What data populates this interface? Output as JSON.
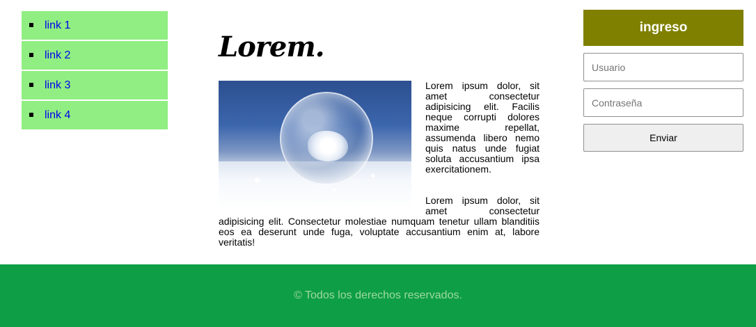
{
  "nav": {
    "items": [
      {
        "label": "link 1"
      },
      {
        "label": "link 2"
      },
      {
        "label": "link 3"
      },
      {
        "label": "link 4"
      }
    ],
    "item_color": "#90ee82",
    "link_color": "#0000ee"
  },
  "main": {
    "title": "Lorem.",
    "image": {
      "icon": "frozen-bubble-photo"
    },
    "paragraphs": [
      "Lorem ipsum dolor, sit amet consectetur adipisicing elit. Facilis neque corrupti dolores maxime repellat, assumenda libero nemo quis natus unde fugiat soluta accusantium ipsa exercitationem.",
      "Lorem ipsum dolor, sit amet consectetur adipisicing elit. Consectetur molestiae numquam tenetur ullam blanditiis eos ea deserunt unde fuga, voluptate accusantium enim at, labore veritatis!"
    ]
  },
  "login": {
    "title": "ingreso",
    "header_color": "#808000",
    "username": {
      "value": "",
      "placeholder": "Usuario"
    },
    "password": {
      "value": "",
      "placeholder": "Contraseña"
    },
    "submit_label": "Enviar"
  },
  "footer": {
    "text": "© Todos los derechos reservados.",
    "background_color": "#0e9e46",
    "text_color": "#9ed99a"
  }
}
